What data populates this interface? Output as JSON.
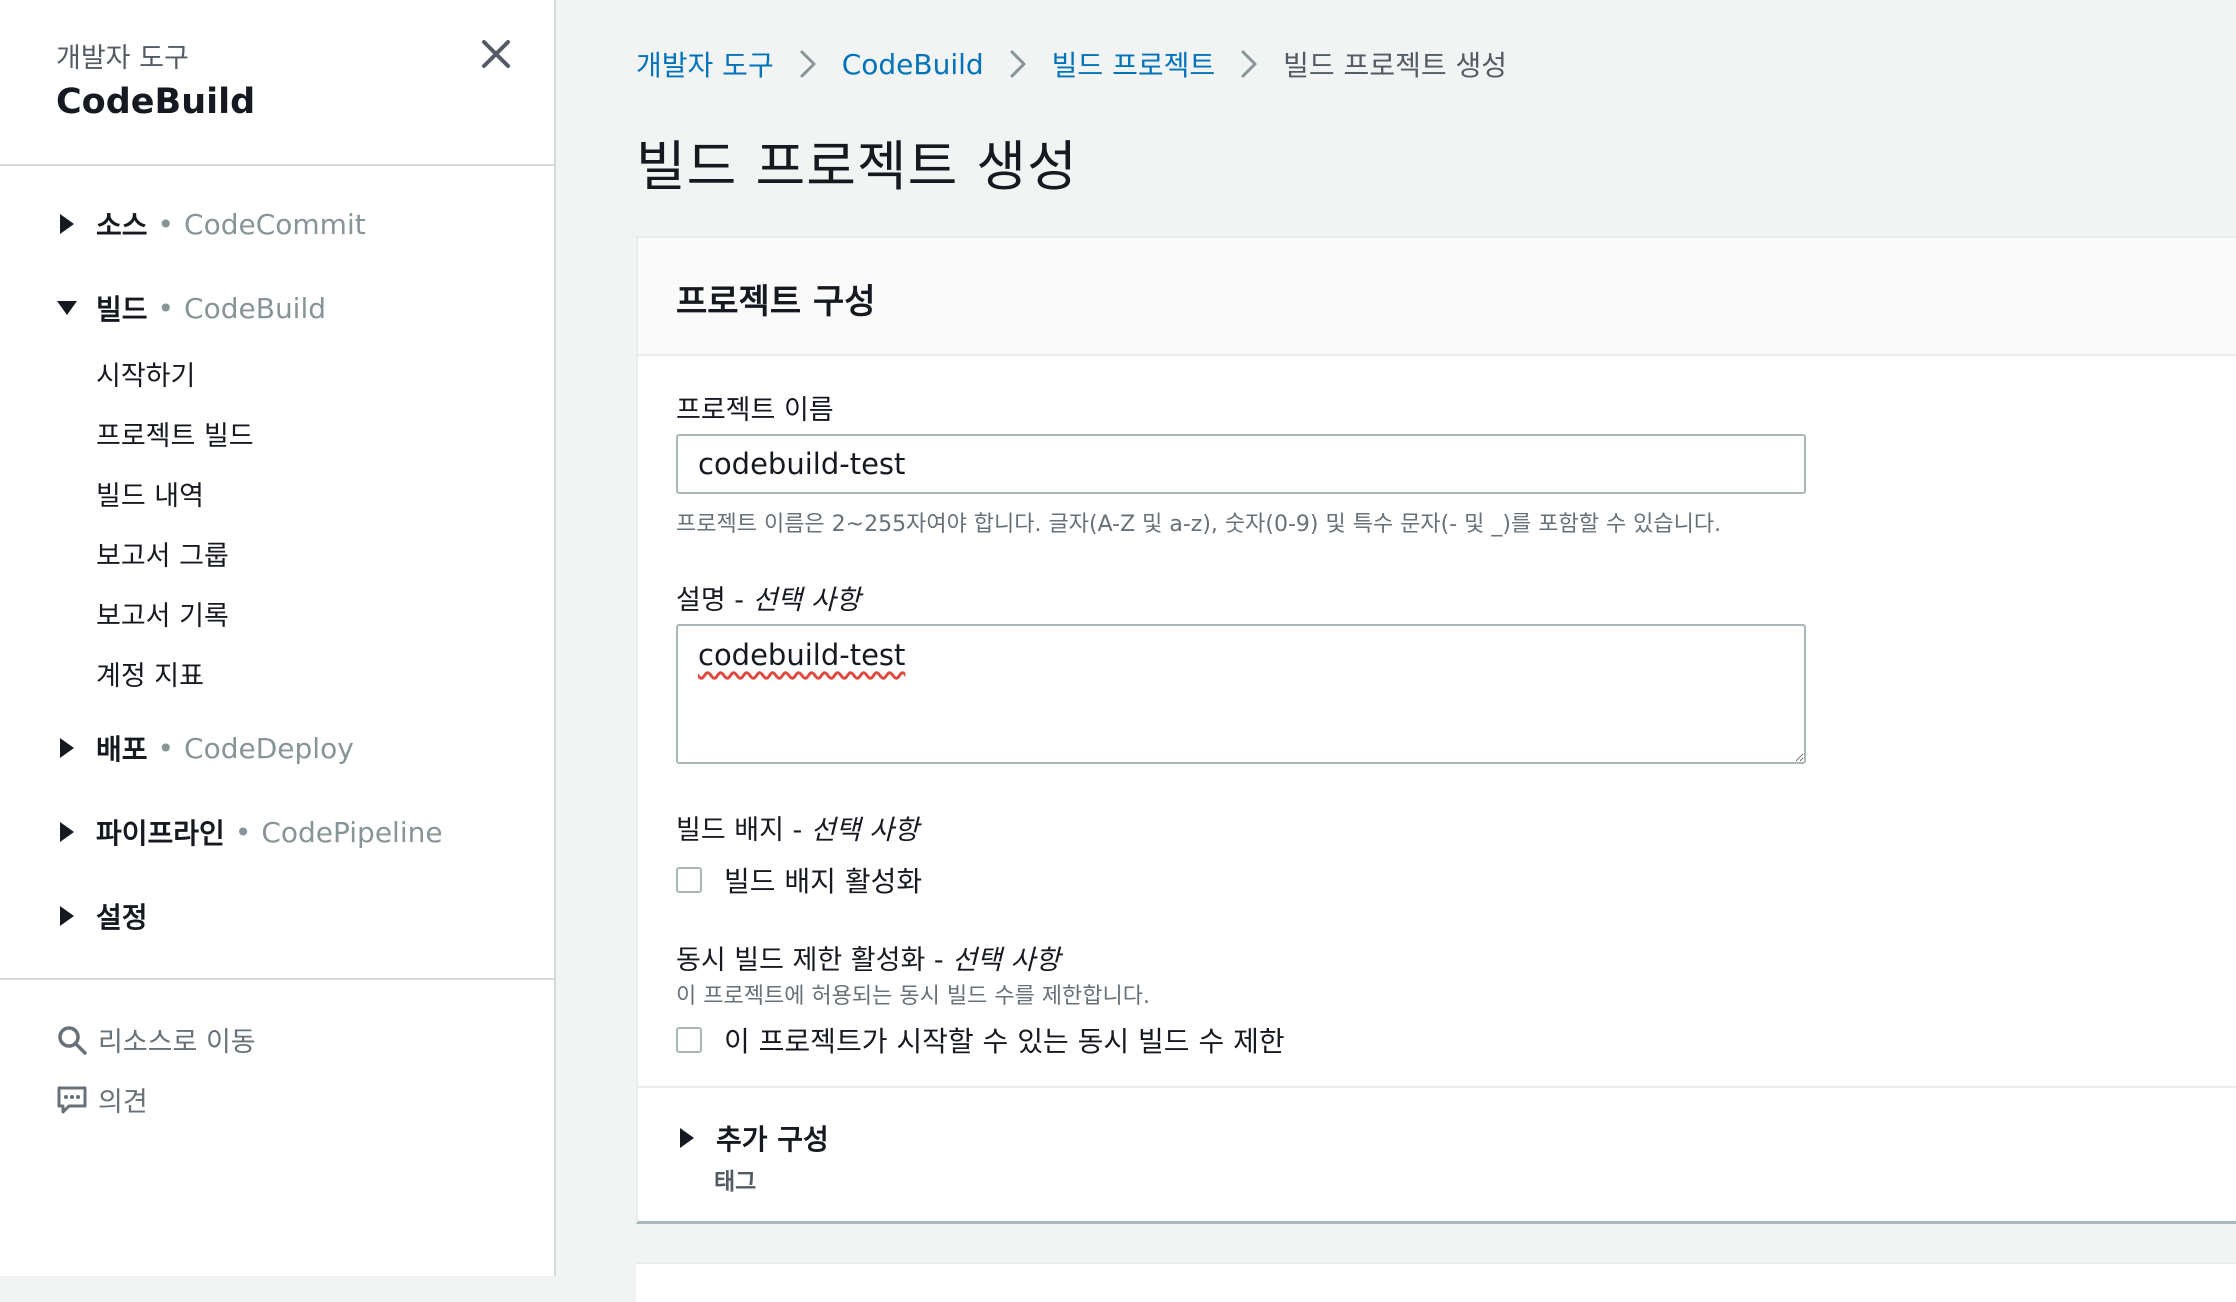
{
  "sidebar": {
    "kicker": "개발자 도구",
    "title": "CodeBuild",
    "sections": [
      {
        "label": "소스",
        "service": "CodeCommit",
        "expanded": false
      },
      {
        "label": "빌드",
        "service": "CodeBuild",
        "expanded": true
      },
      {
        "label": "배포",
        "service": "CodeDeploy",
        "expanded": false
      },
      {
        "label": "파이프라인",
        "service": "CodePipeline",
        "expanded": false
      },
      {
        "label": "설정",
        "service": "",
        "expanded": false
      }
    ],
    "build_items": [
      "시작하기",
      "프로젝트 빌드",
      "빌드 내역",
      "보고서 그룹",
      "보고서 기록",
      "계정 지표"
    ],
    "footer": {
      "goto_resource": "리소스로 이동",
      "feedback": "의견"
    }
  },
  "breadcrumb": {
    "items": [
      "개발자 도구",
      "CodeBuild",
      "빌드 프로젝트"
    ],
    "current": "빌드 프로젝트 생성"
  },
  "page_title": "빌드 프로젝트 생성",
  "project_config": {
    "title": "프로젝트 구성",
    "name_label": "프로젝트 이름",
    "name_value": "codebuild-test",
    "name_hint": "프로젝트 이름은 2~255자여야 합니다. 글자(A-Z 및 a-z), 숫자(0-9) 및 특수 문자(- 및 _)를 포함할 수 있습니다.",
    "desc_label": "설명 - ",
    "optional": "선택 사항",
    "desc_value": "codebuild-test",
    "badge_label": "빌드 배지 - ",
    "badge_checkbox": "빌드 배지 활성화",
    "badge_checked": false,
    "concurrent_label": "동시 빌드 제한 활성화 - ",
    "concurrent_hint": "이 프로젝트에 허용되는 동시 빌드 수를 제한합니다.",
    "concurrent_checkbox": "이 프로젝트가 시작할 수 있는 동시 빌드 수 제한",
    "concurrent_checked": false,
    "additional_title": "추가 구성",
    "additional_sub": "태그"
  },
  "colors": {
    "link": "#0073bb",
    "muted": "#879596",
    "border": "#aab7b8",
    "background": "#f2f3f3"
  }
}
